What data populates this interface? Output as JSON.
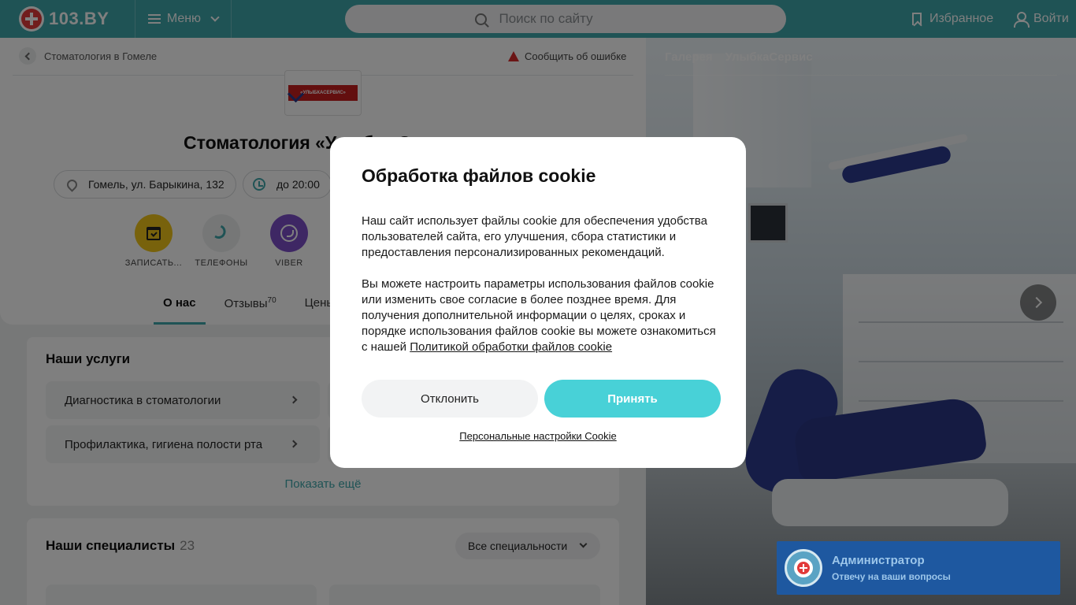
{
  "header": {
    "logo_text": "103.BY",
    "menu_label": "Меню",
    "search_placeholder": "Поиск по сайту",
    "favorites_label": "Избранное",
    "login_label": "Войти",
    "brand_color": "#3ea7ab"
  },
  "breadcrumb": {
    "label": "Стоматология в Гомеле"
  },
  "report_error": "Сообщить об ошибке",
  "clinic": {
    "logo_text": "«УЛЫБКАСЕРВИС»",
    "title": "Стоматология «Улыбка Сервис»",
    "address": "Гомель, ул. Барыкина, 132",
    "hours": "до 20:00"
  },
  "actions": [
    {
      "label": "ЗАПИСАТЬ...",
      "color": "#f0c419"
    },
    {
      "label": "ТЕЛЕФОНЫ",
      "color": "#eceeef"
    },
    {
      "label": "VIBER",
      "color": "#7d4fc9"
    }
  ],
  "tabs": [
    {
      "label": "О нас",
      "active": true
    },
    {
      "label": "Отзывы",
      "count": "70"
    },
    {
      "label": "Цены"
    }
  ],
  "services": {
    "title": "Наши услуги",
    "items": [
      "Диагностика в стоматологии",
      "Профилактика, гигиена полости рта"
    ],
    "show_more": "Показать ещё"
  },
  "specialists": {
    "title": "Наши специалисты",
    "count": "23",
    "filter": "Все специальности"
  },
  "gallery": {
    "title": "Галерея",
    "name": "УлыбкаСервис"
  },
  "cookie_modal": {
    "title": "Обработка файлов cookie",
    "paragraph1": "Наш сайт использует файлы cookie для обеспечения удобства пользователей сайта, его улучшения, сбора статистики и предоставления персонализированных рекомендаций.",
    "paragraph2": "Вы можете настроить параметры использования файлов cookie или изменить свое согласие в более позднее время. Для получения дополнительной информации о целях, сроках и порядке использования файлов cookie вы можете ознакомиться с нашей",
    "policy_link": "Политикой обработки файлов cookie",
    "decline_label": "Отклонить",
    "accept_label": "Принять",
    "personal_settings": "Персональные настройки Cookie",
    "accept_color": "#48d1d7"
  },
  "chat": {
    "name": "Администратор",
    "subtitle": "Отвечу на ваши вопросы",
    "color": "#1e58a0"
  }
}
